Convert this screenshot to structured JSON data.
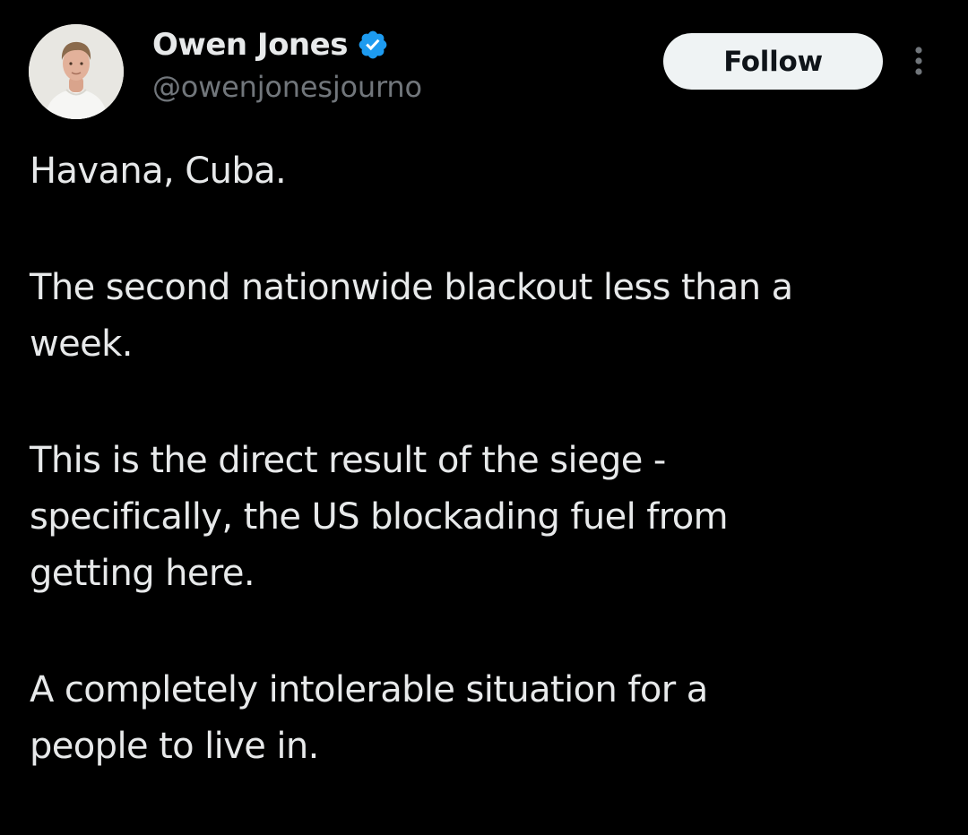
{
  "tweet": {
    "author": {
      "name": "Owen Jones",
      "handle": "@owenjonesjourno",
      "verified_icon": "verified-badge-icon",
      "verified_color": "#1d9bf0"
    },
    "follow_label": "Follow",
    "more_icon": "more-options-icon",
    "paragraphs": [
      {
        "lines": [
          "Havana, Cuba."
        ]
      },
      {
        "lines": [
          "The second nationwide blackout less than a",
          "week."
        ]
      },
      {
        "lines": [
          "This is the direct result of the siege -",
          "specifically, the US blockading fuel from",
          "getting here."
        ]
      },
      {
        "lines": [
          "A completely intolerable situation for a",
          "people to live in."
        ]
      }
    ]
  },
  "colors": {
    "background": "#000000",
    "text_primary": "#e7e9ea",
    "text_secondary": "#71767b",
    "follow_bg": "#eff3f4",
    "follow_text": "#0f1419"
  }
}
